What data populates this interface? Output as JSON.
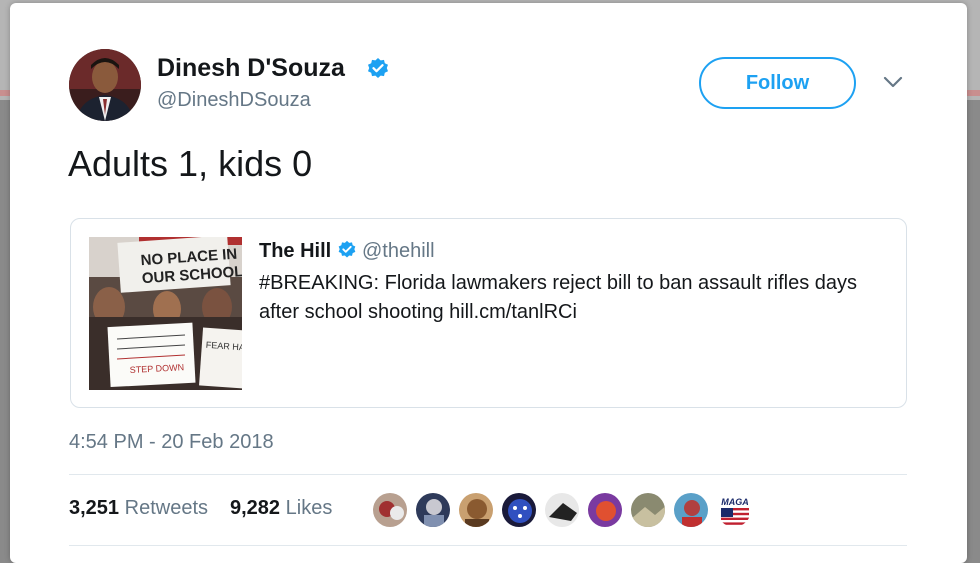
{
  "author": {
    "name": "Dinesh D'Souza",
    "handle": "@DineshDSouza",
    "verified_icon": "verified-badge-icon"
  },
  "actions": {
    "follow_label": "Follow",
    "menu_icon": "chevron-down-icon"
  },
  "tweet": {
    "text": "Adults 1, kids 0",
    "timestamp": "4:54 PM - 20 Feb 2018"
  },
  "quote": {
    "name": "The Hill",
    "handle": "@thehill",
    "text": "#BREAKING: Florida lawmakers reject bill to ban assault rifles days after school shooting hill.cm/tanlRCi",
    "image_signs": [
      "NO PLACE IN",
      "OUR SCHOOLS",
      "FEAR HAS",
      "STEP DOWN"
    ]
  },
  "stats": {
    "retweets_count": "3,251",
    "retweets_label": "Retweets",
    "likes_count": "9,282",
    "likes_label": "Likes"
  },
  "likers": {
    "maga_badge_text": "MAGA"
  },
  "colors": {
    "accent": "#1da1f2",
    "text": "#14171a",
    "secondary": "#657786",
    "border": "#e1e8ed"
  }
}
